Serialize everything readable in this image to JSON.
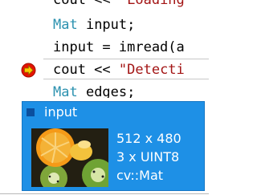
{
  "editor": {
    "lines": [
      {
        "pre": "cout << ",
        "str": "\"Loading",
        "post": "",
        "type": "",
        "rest": ""
      },
      {
        "pre": "",
        "str": "",
        "post": "",
        "type": "Mat",
        "rest": " input;"
      },
      {
        "pre": "input = imread(a",
        "str": "",
        "post": "",
        "type": "",
        "rest": ""
      },
      {
        "pre": "cout << ",
        "str": "\"Detecti",
        "post": "",
        "type": "",
        "rest": ""
      },
      {
        "pre": "",
        "str": "",
        "post": "",
        "type": "Mat",
        "rest": " edges;"
      }
    ]
  },
  "datatip": {
    "variable": "input",
    "size": "512 x 480",
    "format": "3 x UINT8",
    "type": "cv::Mat"
  },
  "colors": {
    "type_keyword": "#2b91af",
    "string_literal": "#a31515",
    "popup_background": "#1e90e6",
    "breakpoint_fill": "#e51400",
    "current_statement_arrow": "#ffcc00"
  }
}
